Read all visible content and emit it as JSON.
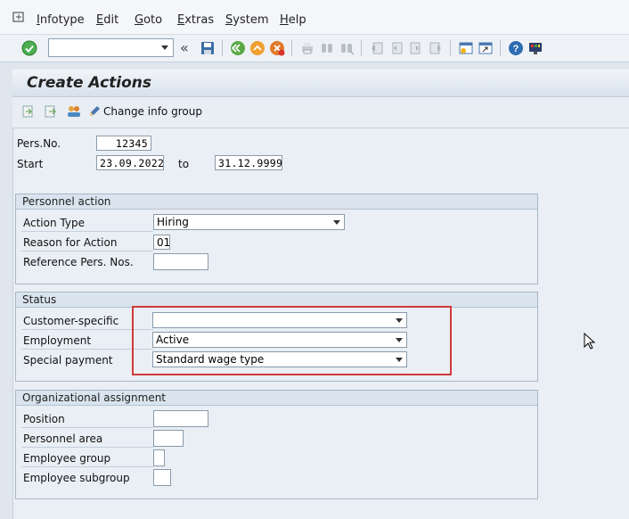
{
  "menu": {
    "items": [
      {
        "label": "Infotype"
      },
      {
        "label": "Edit"
      },
      {
        "label": "Goto"
      },
      {
        "label": "Extras"
      },
      {
        "label": "System"
      },
      {
        "label": "Help"
      }
    ]
  },
  "toolbar": {
    "command_field": ""
  },
  "page": {
    "title": "Create Actions"
  },
  "app_toolbar": {
    "change_info_group_label": "Change info group"
  },
  "header_fields": {
    "pers_no_label": "Pers.No.",
    "pers_no_value": "12345",
    "start_label": "Start",
    "start_value": "23.09.2022",
    "to_label": "to",
    "end_value": "31.12.9999"
  },
  "personnel_action": {
    "title": "Personnel action",
    "action_type_label": "Action Type",
    "action_type_value": "Hiring",
    "reason_label": "Reason for Action",
    "reason_value": "01",
    "ref_pers_label": "Reference Pers. Nos.",
    "ref_pers_value": ""
  },
  "status": {
    "title": "Status",
    "customer_specific_label": "Customer-specific",
    "customer_specific_value": "",
    "employment_label": "Employment",
    "employment_value": "Active",
    "special_payment_label": "Special payment",
    "special_payment_value": "Standard wage type"
  },
  "org_assignment": {
    "title": "Organizational assignment",
    "position_label": "Position",
    "position_value": "",
    "personnel_area_label": "Personnel area",
    "personnel_area_value": "",
    "employee_group_label": "Employee group",
    "employee_group_value": "",
    "employee_subgroup_label": "Employee subgroup",
    "employee_subgroup_value": ""
  },
  "colors": {
    "highlight": "#d23a3a",
    "background": "#dfe6ee"
  }
}
